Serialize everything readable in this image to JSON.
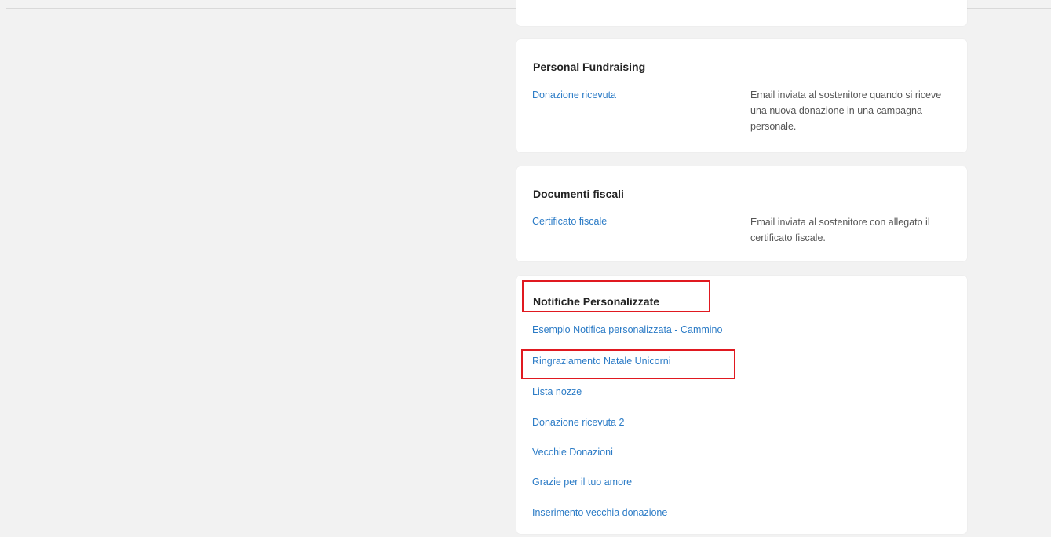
{
  "colors": {
    "background": "#f2f2f2",
    "card": "#ffffff",
    "link": "#2b7bc6",
    "title": "#222222",
    "description": "#555555",
    "highlight": "#e01920"
  },
  "sections": [
    {
      "title": "Personal Fundraising",
      "items": [
        {
          "label": "Donazione ricevuta",
          "description": "Email inviata al sostenitore quando si riceve una nuova donazione in una campagna personale."
        }
      ]
    },
    {
      "title": "Documenti fiscali",
      "items": [
        {
          "label": "Certificato fiscale",
          "description": "Email inviata al sostenitore con allegato il certificato fiscale."
        }
      ]
    },
    {
      "title": "Notifiche Personalizzate",
      "items": [
        {
          "label": "Esempio Notifica personalizzata - Cammino"
        },
        {
          "label": "Ringraziamento Natale Unicorni"
        },
        {
          "label": "Lista nozze"
        },
        {
          "label": "Donazione ricevuta 2"
        },
        {
          "label": "Vecchie Donazioni"
        },
        {
          "label": "Grazie per il tuo amore"
        },
        {
          "label": "Inserimento vecchia donazione"
        }
      ]
    }
  ]
}
